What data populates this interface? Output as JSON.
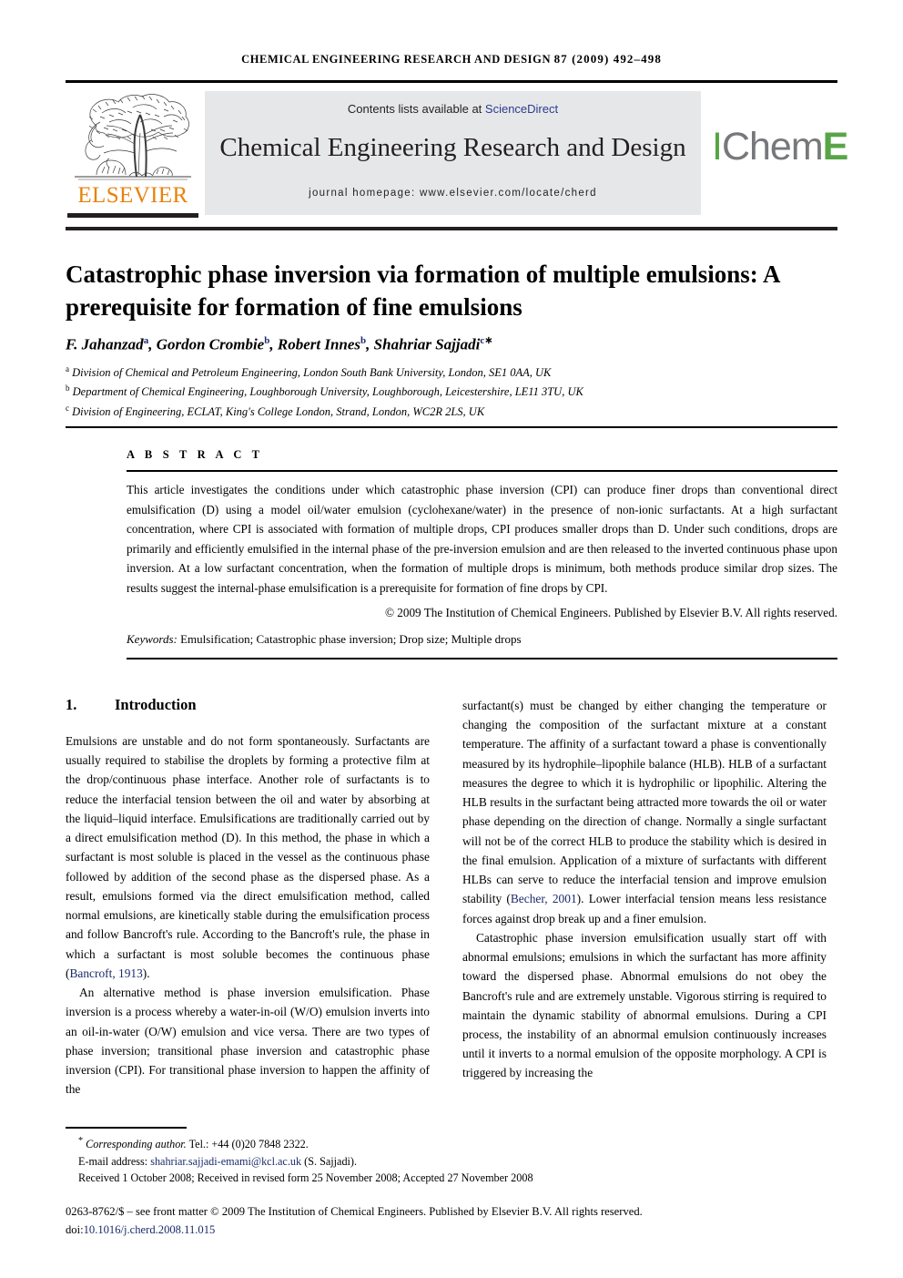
{
  "running_head": {
    "journal": "CHEMICAL ENGINEERING RESEARCH AND DESIGN",
    "volume_pages": "87 (2009) 492–498"
  },
  "masthead": {
    "elsevier_wordmark": "ELSEVIER",
    "contents_prefix": "Contents lists available at ",
    "contents_link": "ScienceDirect",
    "journal_title": "Chemical Engineering Research and Design",
    "homepage": "journal homepage: www.elsevier.com/locate/cherd",
    "icheme_i": "I",
    "icheme_chem": "Chem",
    "icheme_e": "E",
    "colors": {
      "elsevier_orange": "#E8820C",
      "icheme_green": "#58a548",
      "icheme_gray": "#77787b",
      "link_blue": "#2b3b8f",
      "band_gray": "#e6e7e8"
    }
  },
  "article": {
    "title": "Catastrophic phase inversion via formation of multiple emulsions: A prerequisite for formation of fine emulsions",
    "authors": [
      {
        "name": "F. Jahanzad",
        "sup": "a"
      },
      {
        "name": "Gordon Crombie",
        "sup": "b"
      },
      {
        "name": "Robert Innes",
        "sup": "b"
      },
      {
        "name": "Shahriar Sajjadi",
        "sup": "c"
      }
    ],
    "affiliations": [
      {
        "marker": "a",
        "text": "Division of Chemical and Petroleum Engineering, London South Bank University, London, SE1 0AA, UK"
      },
      {
        "marker": "b",
        "text": "Department of Chemical Engineering, Loughborough University, Loughborough, Leicestershire, LE11 3TU, UK"
      },
      {
        "marker": "c",
        "text": "Division of Engineering, ECLAT, King's College London, Strand, London, WC2R 2LS, UK"
      }
    ]
  },
  "abstract": {
    "label": "A B S T R A C T",
    "body": "This article investigates the conditions under which catastrophic phase inversion (CPI) can produce finer drops than conventional direct emulsification (D) using a model oil/water emulsion (cyclohexane/water) in the presence of non-ionic surfactants. At a high surfactant concentration, where CPI is associated with formation of multiple drops, CPI produces smaller drops than D. Under such conditions, drops are primarily and efficiently emulsified in the internal phase of the pre-inversion emulsion and are then released to the inverted continuous phase upon inversion. At a low surfactant concentration, when the formation of multiple drops is minimum, both methods produce similar drop sizes. The results suggest the internal-phase emulsification is a prerequisite for formation of fine drops by CPI.",
    "copyright": "© 2009 The Institution of Chemical Engineers. Published by Elsevier B.V. All rights reserved.",
    "keywords_label": "Keywords:",
    "keywords": "Emulsification; Catastrophic phase inversion; Drop size; Multiple drops"
  },
  "section": {
    "number": "1.",
    "heading": "Introduction"
  },
  "body": {
    "left_paragraphs": [
      "Emulsions are unstable and do not form spontaneously. Surfactants are usually required to stabilise the droplets by forming a protective film at the drop/continuous phase interface. Another role of surfactants is to reduce the interfacial tension between the oil and water by absorbing at the liquid–liquid interface. Emulsifications are traditionally carried out by a direct emulsification method (D). In this method, the phase in which a surfactant is most soluble is placed in the vessel as the continuous phase followed by addition of the second phase as the dispersed phase. As a result, emulsions formed via the direct emulsification method, called normal emulsions, are kinetically stable during the emulsification process and follow Bancroft's rule. According to the Bancroft's rule, the phase in which a surfactant is most soluble becomes the continuous phase (Bancroft, 1913).",
      "An alternative method is phase inversion emulsification. Phase inversion is a process whereby a water-in-oil (W/O) emulsion inverts into an oil-in-water (O/W) emulsion and vice versa. There are two types of phase inversion; transitional phase inversion and catastrophic phase inversion (CPI). For transitional phase inversion to happen the affinity of the"
    ],
    "left_citation_1": "Bancroft, 1913",
    "right_paragraphs": [
      "surfactant(s) must be changed by either changing the temperature or changing the composition of the surfactant mixture at a constant temperature. The affinity of a surfactant toward a phase is conventionally measured by its hydrophile–lipophile balance (HLB). HLB of a surfactant measures the degree to which it is hydrophilic or lipophilic. Altering the HLB results in the surfactant being attracted more towards the oil or water phase depending on the direction of change. Normally a single surfactant will not be of the correct HLB to produce the stability which is desired in the final emulsion. Application of a mixture of surfactants with different HLBs can serve to reduce the interfacial tension and improve emulsion stability (Becher, 2001). Lower interfacial tension means less resistance forces against drop break up and a finer emulsion.",
      "Catastrophic phase inversion emulsification usually start off with abnormal emulsions; emulsions in which the surfactant has more affinity toward the dispersed phase. Abnormal emulsions do not obey the Bancroft's rule and are extremely unstable. Vigorous stirring is required to maintain the dynamic stability of abnormal emulsions. During a CPI process, the instability of an abnormal emulsion continuously increases until it inverts to a normal emulsion of the opposite morphology. A CPI is triggered by increasing the"
    ],
    "right_citation_1": "Becher, 2001"
  },
  "footer": {
    "corresponding_star": "*",
    "corresponding_text": "Corresponding author.",
    "tel": "Tel.: +44 (0)20 7848 2322.",
    "email_label": "E-mail address:",
    "email": "shahriar.sajjadi-emami@kcl.ac.uk",
    "email_owner": "(S. Sajjadi).",
    "received": "Received 1 October 2008; Received in revised form 25 November 2008; Accepted 27 November 2008",
    "frontmatter": "0263-8762/$ – see front matter © 2009 The Institution of Chemical Engineers. Published by Elsevier B.V. All rights reserved.",
    "doi_label": "doi:",
    "doi": "10.1016/j.cherd.2008.11.015"
  }
}
